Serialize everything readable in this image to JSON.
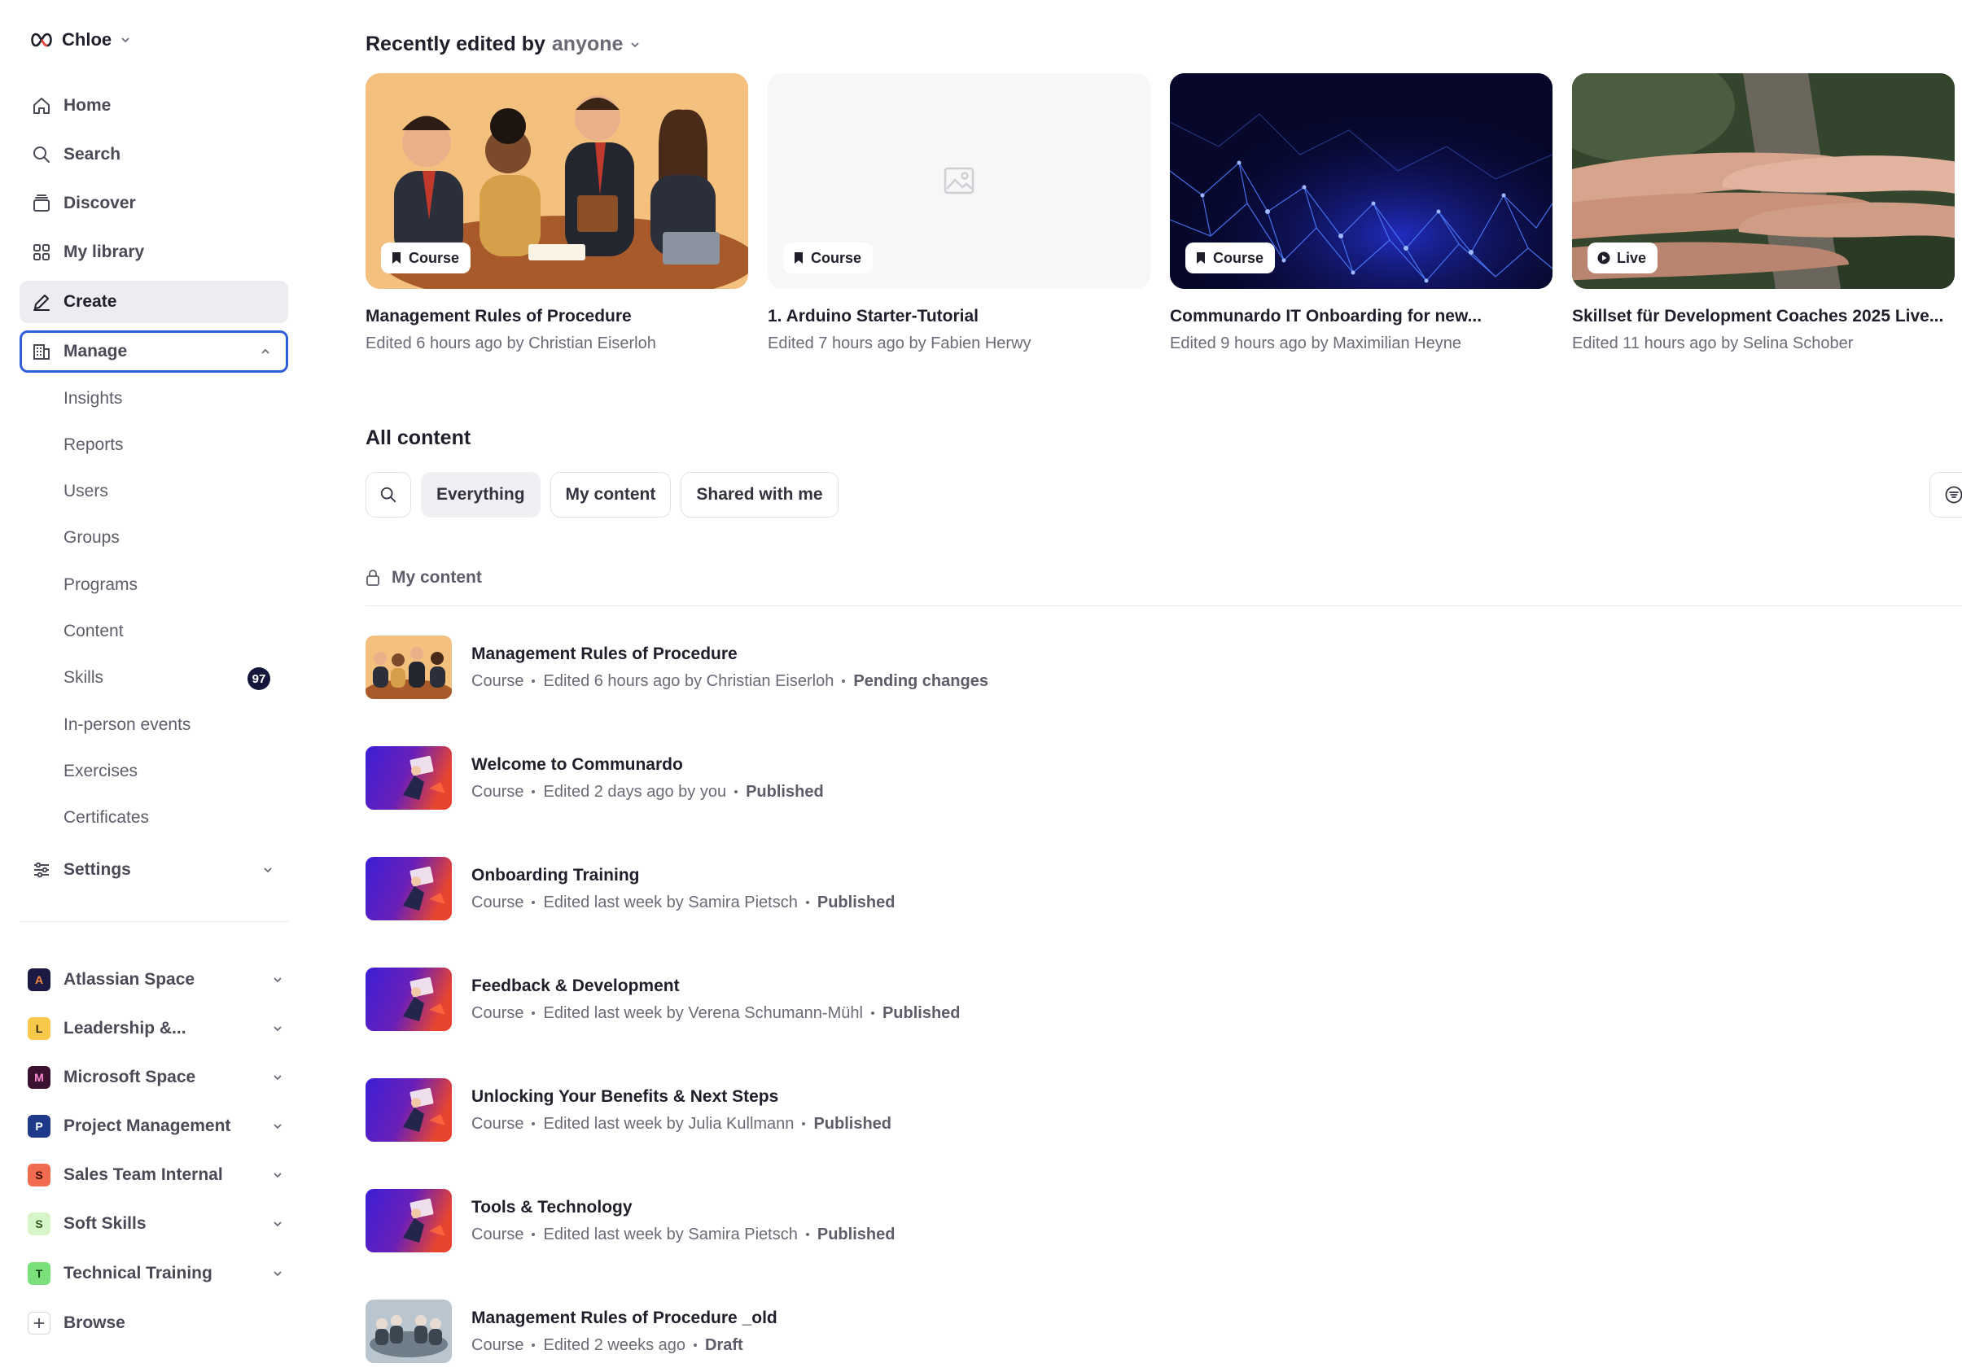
{
  "profile": {
    "name": "Chloe"
  },
  "nav": {
    "home": "Home",
    "search": "Search",
    "discover": "Discover",
    "library": "My library",
    "create": "Create",
    "manage": "Manage",
    "settings": "Settings"
  },
  "manage_items": [
    "Insights",
    "Reports",
    "Users",
    "Groups",
    "Programs",
    "Content",
    "Skills",
    "In-person events",
    "Exercises",
    "Certificates"
  ],
  "skills_badge": "97",
  "spaces": [
    {
      "initial": "A",
      "label": "Atlassian Space",
      "bg": "#1c1a45",
      "fg": "#ff8a3d"
    },
    {
      "initial": "L",
      "label": "Leadership &...",
      "bg": "#f6c94a",
      "fg": "#3a2e00"
    },
    {
      "initial": "M",
      "label": "Microsoft Space",
      "bg": "#3a1230",
      "fg": "#ff8ad0"
    },
    {
      "initial": "P",
      "label": "Project Management",
      "bg": "#1f3a8a",
      "fg": "#ffffff"
    },
    {
      "initial": "S",
      "label": "Sales Team Internal",
      "bg": "#f06b4f",
      "fg": "#3a0c00"
    },
    {
      "initial": "S",
      "label": "Soft Skills",
      "bg": "#d7f5c8",
      "fg": "#2d5a1a"
    },
    {
      "initial": "T",
      "label": "Technical Training",
      "bg": "#7be07b",
      "fg": "#0f3d0f"
    }
  ],
  "browse": "Browse",
  "recent": {
    "title": "Recently edited by",
    "filter": "anyone",
    "cards": [
      {
        "badge": "Course",
        "title": "Management Rules of Procedure",
        "sub": "Edited 6 hours ago by Christian Eiserloh"
      },
      {
        "badge": "Course",
        "title": "1. Arduino Starter-Tutorial",
        "sub": "Edited 7 hours ago by Fabien Herwy"
      },
      {
        "badge": "Course",
        "title": "Communardo IT Onboarding for new...",
        "sub": "Edited 9 hours ago by Maximilian Heyne"
      },
      {
        "badge": "Live",
        "title": "Skillset für Development Coaches 2025 Live...",
        "sub": "Edited 11 hours ago by Selina Schober"
      }
    ]
  },
  "all_content": {
    "title": "All content",
    "filters": [
      "Everything",
      "My content",
      "Shared with me"
    ],
    "group_label": "My content",
    "rows": [
      {
        "title": "Management Rules of Procedure",
        "type": "Course",
        "edited": "Edited 6 hours ago by Christian Eiserloh",
        "status": "Pending changes"
      },
      {
        "title": "Welcome to Communardo",
        "type": "Course",
        "edited": "Edited 2 days ago by you",
        "status": "Published"
      },
      {
        "title": "Onboarding Training",
        "type": "Course",
        "edited": "Edited last week by Samira Pietsch",
        "status": "Published"
      },
      {
        "title": "Feedback & Development",
        "type": "Course",
        "edited": "Edited last week by Verena Schumann-Mühl",
        "status": "Published"
      },
      {
        "title": "Unlocking Your Benefits & Next Steps",
        "type": "Course",
        "edited": "Edited last week by Julia Kullmann",
        "status": "Published"
      },
      {
        "title": "Tools & Technology",
        "type": "Course",
        "edited": "Edited last week by Samira Pietsch",
        "status": "Published"
      },
      {
        "title": "Management Rules of Procedure _old",
        "type": "Course",
        "edited": "Edited 2 weeks ago",
        "status": "Draft"
      }
    ]
  }
}
